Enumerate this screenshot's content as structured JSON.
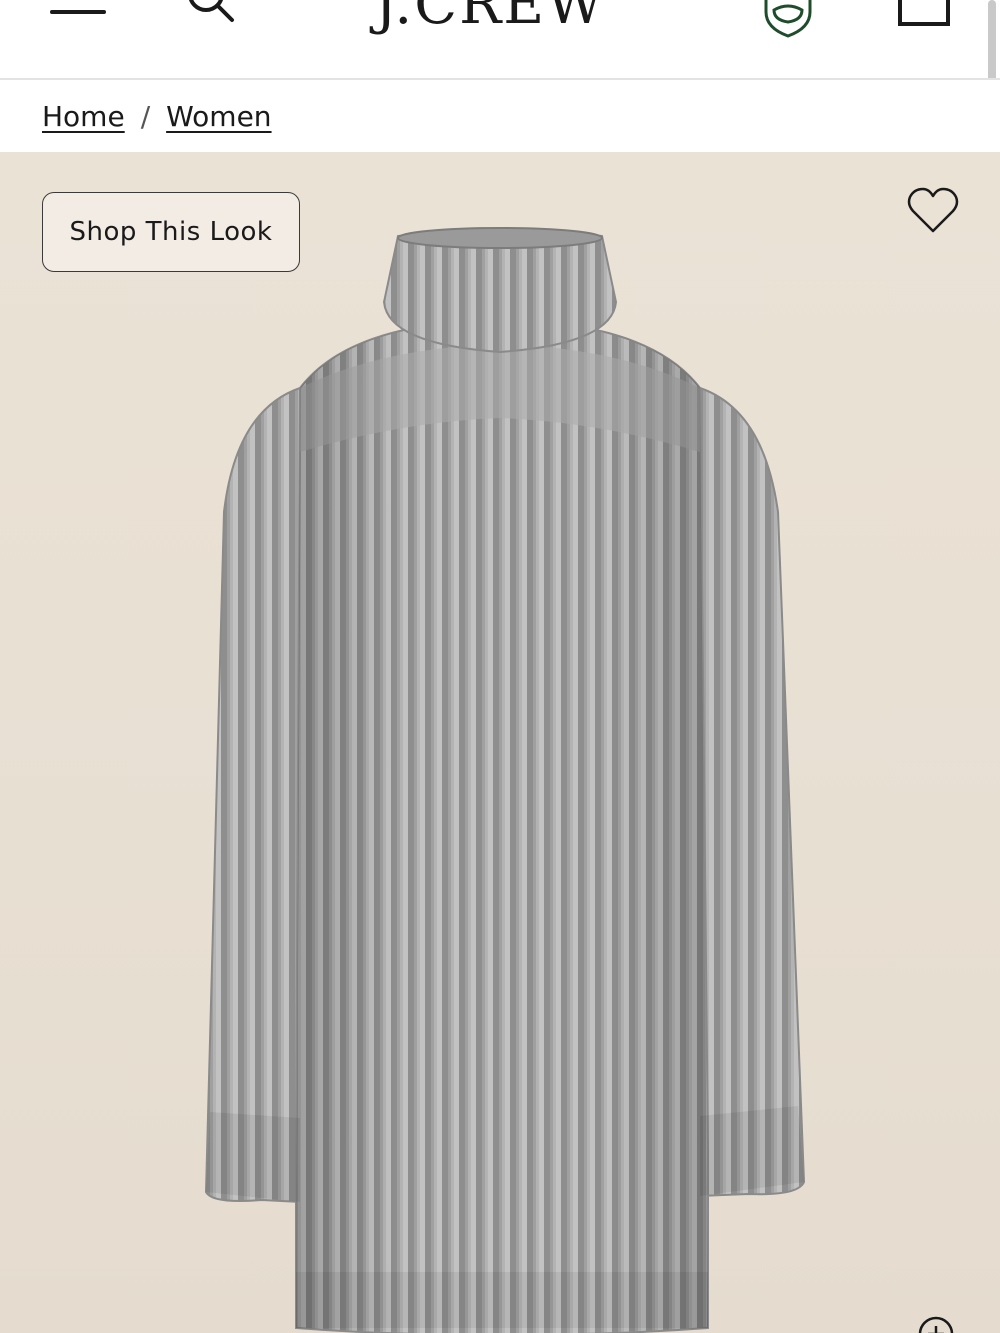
{
  "header": {
    "logo_text": "J.CREW",
    "icons": {
      "menu": "hamburger-icon",
      "search": "search-icon",
      "rewards": "rewards-badge-icon",
      "bag": "shopping-bag-icon"
    },
    "accent_color": "#1f4d2b"
  },
  "breadcrumb": {
    "items": [
      {
        "label": "Home"
      },
      {
        "label": "Women"
      }
    ],
    "separator": "/"
  },
  "product": {
    "shop_look_label": "Shop This Look",
    "background_color": "#e9e0d4",
    "garment_color": "#a8a8a8",
    "icons": {
      "wishlist": "heart-icon",
      "zoom": "zoom-icon"
    }
  }
}
